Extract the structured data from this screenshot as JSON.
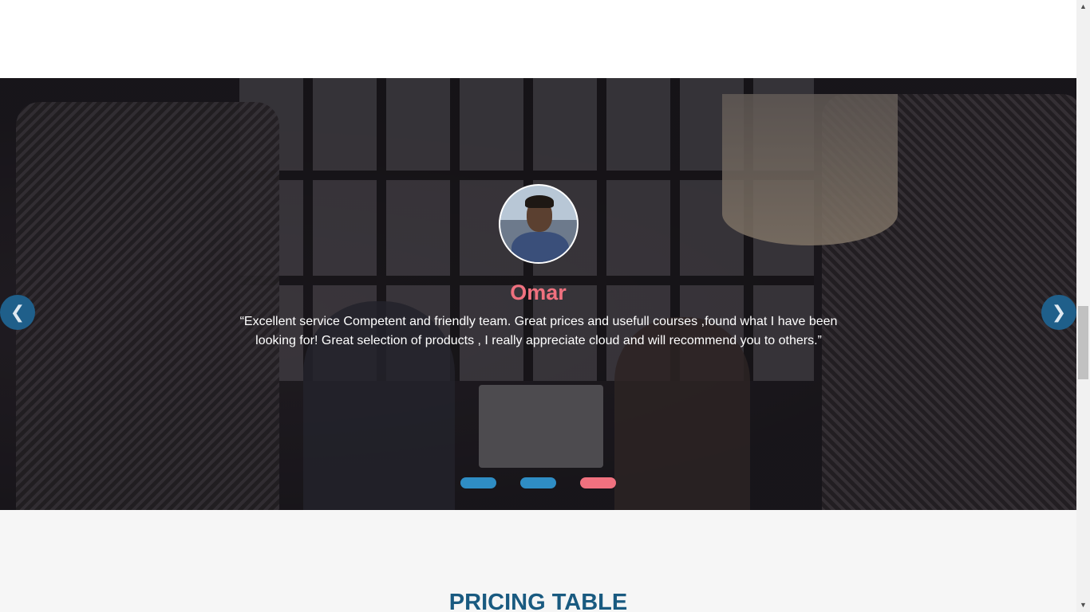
{
  "testimonial": {
    "name": "Omar",
    "quote": "“Excellent service Competent and friendly team. Great prices and usefull courses ,found what I have been looking for! Great selection of products , I really appreciate cloud and will recommend you to others.”",
    "prev_icon": "chevron-left-icon",
    "next_icon": "chevron-right-icon",
    "slide_count": 3,
    "active_slide": 3,
    "colors": {
      "name": "#f0717f",
      "arrow": "#1f5f8a",
      "dot": "#2f8dc4",
      "dot_active": "#f0717f"
    }
  },
  "pricing": {
    "title": "PRICING TABLE",
    "title_color": "#195a80"
  },
  "scrollbar": {
    "up_icon": "scroll-up-arrow-icon",
    "down_icon": "scroll-down-arrow-icon"
  }
}
